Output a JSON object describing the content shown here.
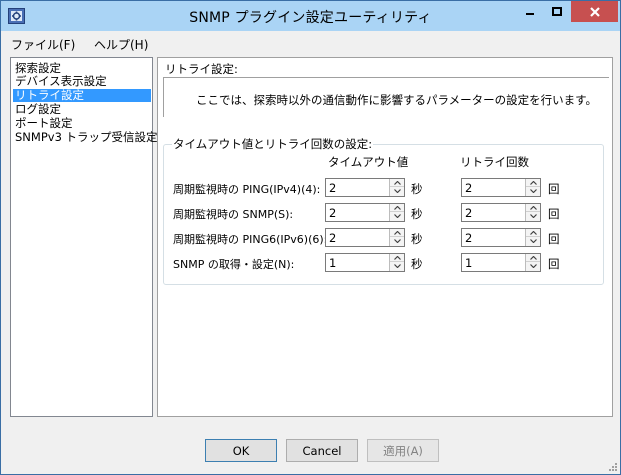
{
  "window": {
    "title": "SNMP プラグイン設定ユーティリティ",
    "app_icon": "gear-document-icon"
  },
  "menubar": {
    "items": [
      {
        "label": "ファイル(F)"
      },
      {
        "label": "ヘルプ(H)"
      }
    ]
  },
  "tree": {
    "items": [
      {
        "label": "探索設定"
      },
      {
        "label": "デバイス表示設定"
      },
      {
        "label": "リトライ設定"
      },
      {
        "label": "ログ設定"
      },
      {
        "label": "ポート設定"
      },
      {
        "label": "SNMPv3 トラップ受信設定"
      }
    ],
    "selected_index": 2
  },
  "panel": {
    "section_title": "リトライ設定:",
    "description": "ここでは、探索時以外の通信動作に影響するパラメーターの設定を行います。",
    "group_label": "タイムアウト値とリトライ回数の設定:",
    "col_timeout": "タイムアウト値",
    "col_retry": "リトライ回数",
    "rows": [
      {
        "label": "周期監視時の PING(IPv4)(4):",
        "timeout": "2",
        "timeout_unit": "秒",
        "retry": "2",
        "retry_unit": "回"
      },
      {
        "label": "周期監視時の SNMP(S):",
        "timeout": "2",
        "timeout_unit": "秒",
        "retry": "2",
        "retry_unit": "回"
      },
      {
        "label": "周期監視時の PING6(IPv6)(6):",
        "timeout": "2",
        "timeout_unit": "秒",
        "retry": "2",
        "retry_unit": "回"
      },
      {
        "label": "SNMP の取得・設定(N):",
        "timeout": "1",
        "timeout_unit": "秒",
        "retry": "1",
        "retry_unit": "回"
      }
    ]
  },
  "buttons": {
    "ok": "OK",
    "cancel": "Cancel",
    "apply": "適用(A)"
  },
  "colors": {
    "titlebar": "#aad4f5",
    "close": "#c75050",
    "selection": "#3399ff"
  }
}
